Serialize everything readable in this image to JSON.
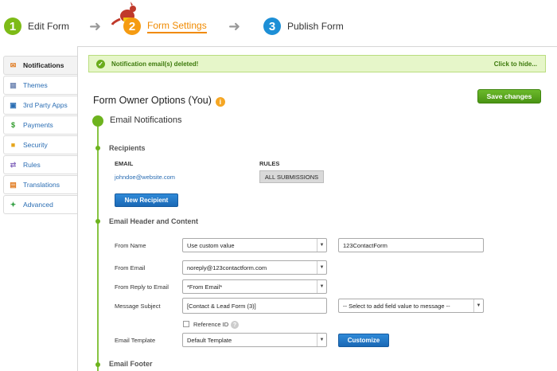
{
  "steps": [
    {
      "num": "1",
      "label": "Edit Form"
    },
    {
      "num": "2",
      "label": "Form Settings"
    },
    {
      "num": "3",
      "label": "Publish Form"
    }
  ],
  "sidebar": {
    "items": [
      {
        "label": "Notifications",
        "icon": "envelope-icon",
        "color": "#e07a1f"
      },
      {
        "label": "Themes",
        "icon": "grid-icon",
        "color": "#7a8fb8"
      },
      {
        "label": "3rd Party Apps",
        "icon": "window-icon",
        "color": "#2a6db3"
      },
      {
        "label": "Payments",
        "icon": "dollar-icon",
        "color": "#2f9a2a"
      },
      {
        "label": "Security",
        "icon": "lock-icon",
        "color": "#e6a51a"
      },
      {
        "label": "Rules",
        "icon": "branch-icon",
        "color": "#8a6fc0"
      },
      {
        "label": "Translations",
        "icon": "translate-icon",
        "color": "#e07a1f"
      },
      {
        "label": "Advanced",
        "icon": "nodes-icon",
        "color": "#3aa34a"
      }
    ]
  },
  "notification": {
    "message": "Notification email(s) deleted!",
    "hide_link": "Click to hide..."
  },
  "owner": {
    "title": "Form Owner Options (You)",
    "save_label": "Save changes"
  },
  "email_notifications": {
    "title": "Email Notifications",
    "recipients": {
      "title": "Recipients",
      "email_header": "EMAIL",
      "rules_header": "RULES",
      "email": "johndoe@website.com",
      "rule": "ALL SUBMISSIONS",
      "new_recipient_label": "New Recipient"
    },
    "header_content": {
      "title": "Email Header and Content",
      "from_name_label": "From Name",
      "from_name_select": "Use custom value",
      "from_name_value": "123ContactForm",
      "from_email_label": "From Email",
      "from_email_value": "noreply@123contactform.com",
      "reply_to_label": "From Reply to Email",
      "reply_to_value": "*From Email*",
      "subject_label": "Message Subject",
      "subject_value": "[Contact & Lead Form (3)]",
      "field_select": "-- Select to add field value to message --",
      "reference_id_label": "Reference ID",
      "template_label": "Email Template",
      "template_value": "Default Template",
      "customize_label": "Customize"
    },
    "footer_title": "Email Footer"
  }
}
